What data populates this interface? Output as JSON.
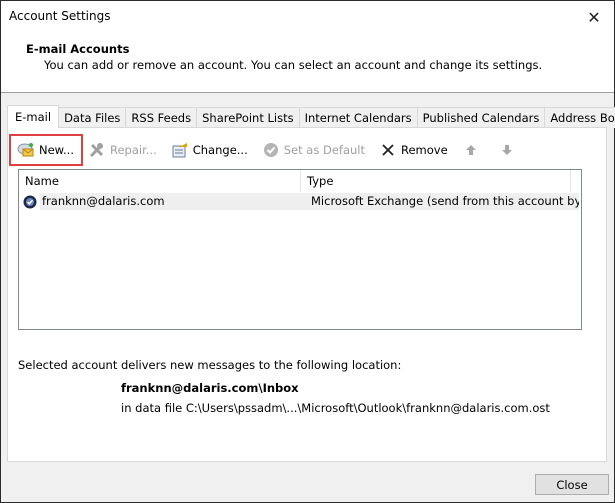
{
  "window": {
    "title": "Account Settings",
    "close_icon": "close-icon"
  },
  "header": {
    "title": "E-mail Accounts",
    "description": "You can add or remove an account. You can select an account and change its settings."
  },
  "tabs": [
    {
      "label": "E-mail",
      "active": true
    },
    {
      "label": "Data Files",
      "active": false
    },
    {
      "label": "RSS Feeds",
      "active": false
    },
    {
      "label": "SharePoint Lists",
      "active": false
    },
    {
      "label": "Internet Calendars",
      "active": false
    },
    {
      "label": "Published Calendars",
      "active": false
    },
    {
      "label": "Address Books",
      "active": false
    }
  ],
  "toolbar": {
    "new_label": "New...",
    "repair_label": "Repair...",
    "change_label": "Change...",
    "set_default_label": "Set as Default",
    "remove_label": "Remove",
    "highlight_color": "#e04040"
  },
  "list": {
    "columns": [
      "Name",
      "Type"
    ],
    "rows": [
      {
        "name": "franknn@dalaris.com",
        "type": "Microsoft Exchange (send from this account by def..."
      }
    ]
  },
  "delivery": {
    "label": "Selected account delivers new messages to the following location:",
    "folder": "franknn@dalaris.com\\Inbox",
    "file": "in data file C:\\Users\\pssadm\\...\\Microsoft\\Outlook\\franknn@dalaris.com.ost"
  },
  "footer": {
    "close_label": "Close"
  }
}
